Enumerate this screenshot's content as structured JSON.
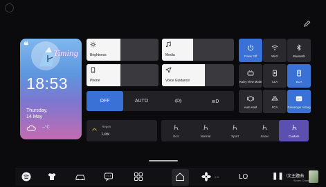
{
  "widget": {
    "quote_mark": "❝",
    "brand": "Timing",
    "time": "18:53",
    "day": "Thursday,",
    "date": "14 May",
    "temperature": "--°C"
  },
  "sliders": [
    {
      "id": "brightness",
      "label": "Brightness",
      "icon": "sun-icon",
      "level": 0.47
    },
    {
      "id": "media",
      "label": "Media",
      "icon": "music-note-icon",
      "level": 0.43
    },
    {
      "id": "phone",
      "label": "Phone",
      "icon": "phone-icon",
      "level": 0.47
    },
    {
      "id": "voice",
      "label": "Voice Guidance",
      "icon": "navigation-arrow-icon",
      "level": 0.6
    }
  ],
  "quick_buttons": [
    {
      "id": "power",
      "label": "Power Off",
      "icon": "power-icon",
      "active": true
    },
    {
      "id": "wifi",
      "label": "Wi-Fi",
      "icon": "wifi-icon",
      "active": false
    },
    {
      "id": "bluetooth",
      "label": "Bluetooth",
      "icon": "bluetooth-icon",
      "active": false
    },
    {
      "id": "rainy",
      "label": "Rainy View Mode",
      "icon": "rainy-view-icon",
      "active": false
    },
    {
      "id": "cla",
      "label": "CLA",
      "icon": "seat-cla-icon",
      "active": false
    },
    {
      "id": "bca",
      "label": "BCA",
      "icon": "seat-bca-icon",
      "active": true
    },
    {
      "id": "autohold",
      "label": "Auto Hold",
      "icon": "auto-hold-icon",
      "active": false
    },
    {
      "id": "fca",
      "label": "FCA",
      "icon": "fca-icon",
      "active": false
    },
    {
      "id": "airbag",
      "label": "Passenger Airbag",
      "icon": "airbag-icon",
      "active": true
    }
  ],
  "light_modes": [
    {
      "id": "off",
      "label": "OFF",
      "active": true
    },
    {
      "id": "auto",
      "label": "AUTO",
      "active": false
    },
    {
      "id": "parking",
      "label": "⦉D⦊",
      "active": false
    },
    {
      "id": "lowbeam",
      "label": "≣D",
      "active": false
    }
  ],
  "regen": {
    "title": "Regen",
    "value": "Low"
  },
  "drive_modes": [
    {
      "id": "eco",
      "label": "Eco",
      "active": false
    },
    {
      "id": "normal",
      "label": "Normal",
      "active": false
    },
    {
      "id": "sport",
      "label": "Sport",
      "active": false
    },
    {
      "id": "snow",
      "label": "Snow",
      "active": false
    },
    {
      "id": "custom",
      "label": "Custom",
      "active": true
    }
  ],
  "dock": {
    "fan_value": "--",
    "temp_value": "LO",
    "pause_symbol": "❚❚",
    "media_title": "¹文主題曲",
    "media_subtitle": "Seven Chan"
  },
  "colors": {
    "accent": "#3a71d6",
    "custom_mode": "#5b4fb0",
    "tile": "#2a2a2e"
  }
}
